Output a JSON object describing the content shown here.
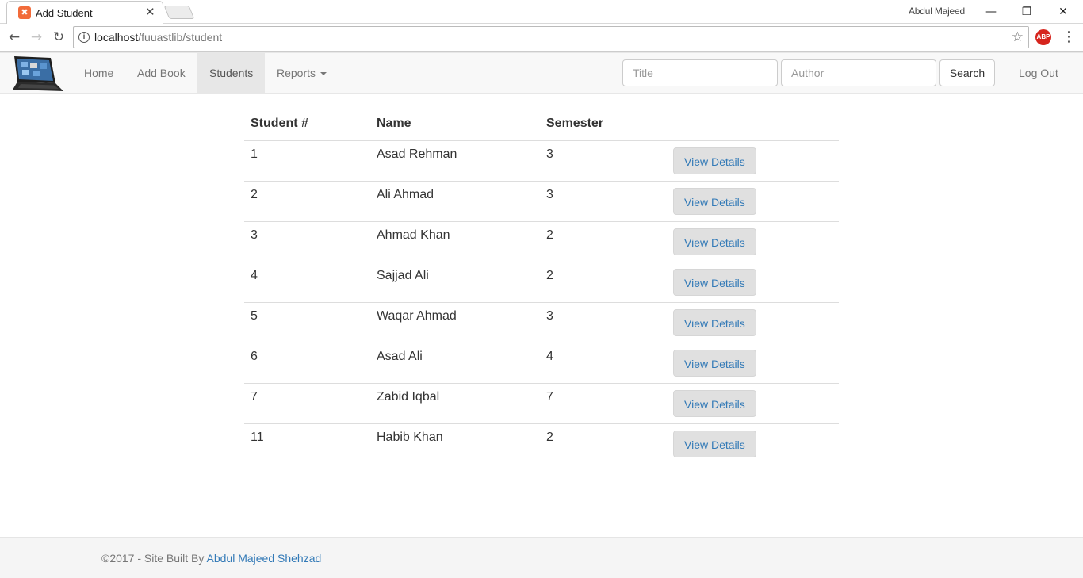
{
  "browser": {
    "tab_title": "Add Student",
    "profile_name": "Abdul Majeed",
    "url_host": "localhost",
    "url_path": "/fuuastlib/student",
    "extension_label": "ABP"
  },
  "navbar": {
    "items": [
      {
        "label": "Home"
      },
      {
        "label": "Add Book"
      },
      {
        "label": "Students",
        "active": true
      },
      {
        "label": "Reports"
      }
    ],
    "title_placeholder": "Title",
    "author_placeholder": "Author",
    "search_label": "Search",
    "logout_label": "Log Out"
  },
  "table": {
    "headers": [
      "Student #",
      "Name",
      "Semester",
      ""
    ],
    "button_label": "View Details",
    "rows": [
      {
        "id": "1",
        "name": "Asad Rehman",
        "semester": "3"
      },
      {
        "id": "2",
        "name": "Ali Ahmad",
        "semester": "3"
      },
      {
        "id": "3",
        "name": "Ahmad Khan",
        "semester": "2"
      },
      {
        "id": "4",
        "name": "Sajjad Ali",
        "semester": "2"
      },
      {
        "id": "5",
        "name": "Waqar Ahmad",
        "semester": "3"
      },
      {
        "id": "6",
        "name": "Asad Ali",
        "semester": "4"
      },
      {
        "id": "7",
        "name": "Zabid Iqbal",
        "semester": "7"
      },
      {
        "id": "11",
        "name": "Habib Khan",
        "semester": "2"
      }
    ]
  },
  "footer": {
    "prefix": "©2017 - Site Built By ",
    "author_link": "Abdul Majeed Shehzad"
  },
  "colors": {
    "link": "#337ab7",
    "navbar_bg": "#f8f8f8",
    "active_nav_bg": "#e7e7e7",
    "button_bg": "#e0e0e0"
  }
}
